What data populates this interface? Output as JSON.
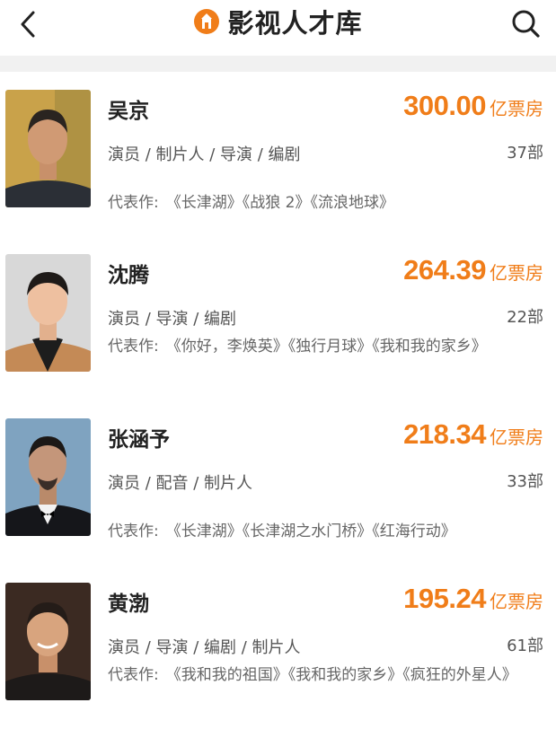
{
  "header": {
    "title": "影视人才库",
    "back_icon": "chevron-left-icon",
    "search_icon": "search-icon",
    "accent_color": "#f07d19"
  },
  "people": [
    {
      "name": "吴京",
      "box_office": "300.00",
      "box_unit": "亿票房",
      "roles": "演员 / 制片人 / 导演 / 编剧",
      "count": "37部",
      "works_label": "代表作:",
      "works": "《长津湖》《战狼 2》《流浪地球》"
    },
    {
      "name": "沈腾",
      "box_office": "264.39",
      "box_unit": "亿票房",
      "roles": "演员 / 导演 / 编剧",
      "count": "22部",
      "works_label": "代表作:",
      "works": "《你好，李焕英》《独行月球》《我和我的家乡》"
    },
    {
      "name": "张涵予",
      "box_office": "218.34",
      "box_unit": "亿票房",
      "roles": "演员 / 配音 / 制片人",
      "count": "33部",
      "works_label": "代表作:",
      "works": "《长津湖》《长津湖之水门桥》《红海行动》"
    },
    {
      "name": "黄渤",
      "box_office": "195.24",
      "box_unit": "亿票房",
      "roles": "演员 / 导演 / 编剧 / 制片人",
      "count": "61部",
      "works_label": "代表作:",
      "works": "《我和我的祖国》《我和我的家乡》《疯狂的外星人》"
    }
  ]
}
